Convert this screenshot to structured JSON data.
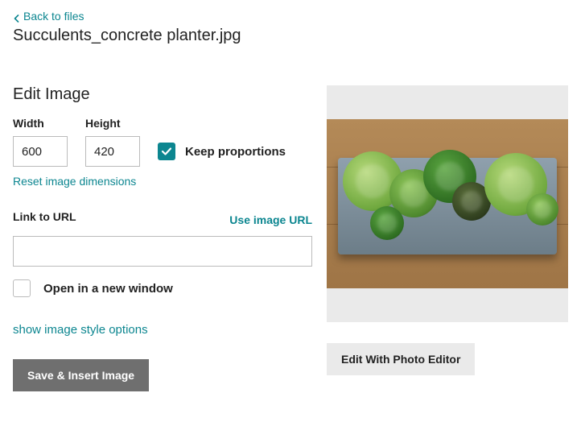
{
  "back_link": "Back to files",
  "filename": "Succulents_concrete planter.jpg",
  "edit_title": "Edit Image",
  "dims": {
    "width_label": "Width",
    "width_value": "600",
    "height_label": "Height",
    "height_value": "420",
    "keep_prop_label": "Keep proportions",
    "keep_prop_checked": true,
    "reset_label": "Reset image dimensions"
  },
  "url": {
    "label": "Link to URL",
    "use_url": "Use image URL",
    "value": "",
    "new_window_label": "Open in a new window",
    "new_window_checked": false
  },
  "style_link": "show image style options",
  "save_btn": "Save & Insert Image",
  "edit_photo_btn": "Edit With Photo Editor"
}
